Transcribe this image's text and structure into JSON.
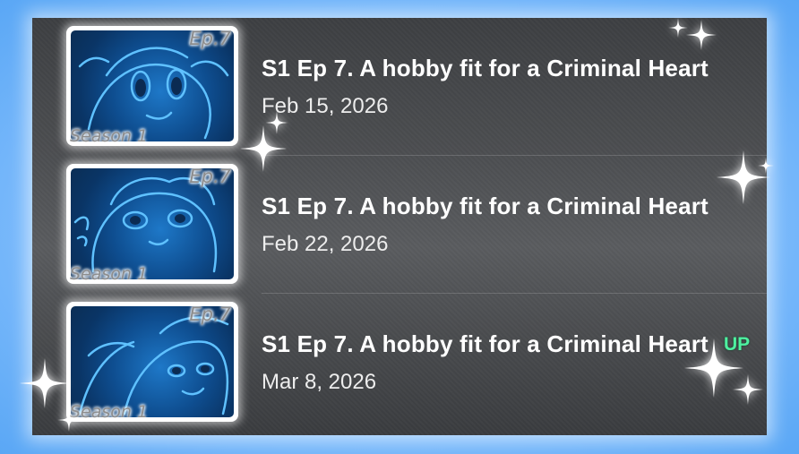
{
  "episodes": [
    {
      "title": "S1 Ep 7. A hobby fit for a Criminal Heart",
      "date": "Feb 15, 2026",
      "thumb_ep": "Ep.7",
      "thumb_season": "Season 1",
      "badge": ""
    },
    {
      "title": "S1 Ep 7. A hobby fit for a Criminal Heart",
      "date": "Feb 22, 2026",
      "thumb_ep": "Ep.7",
      "thumb_season": "Season 1",
      "badge": ""
    },
    {
      "title": "S1 Ep 7. A hobby fit for a Criminal Heart",
      "date": "Mar 8, 2026",
      "thumb_ep": "Ep.7",
      "thumb_season": "Season 1",
      "badge": "UP"
    }
  ],
  "icons": {
    "sparkle": "sparkle-icon"
  },
  "colors": {
    "up_badge": "#4ef0a0",
    "thumb_art": "#1e78c8",
    "outer_background": "#8cc4ff"
  }
}
